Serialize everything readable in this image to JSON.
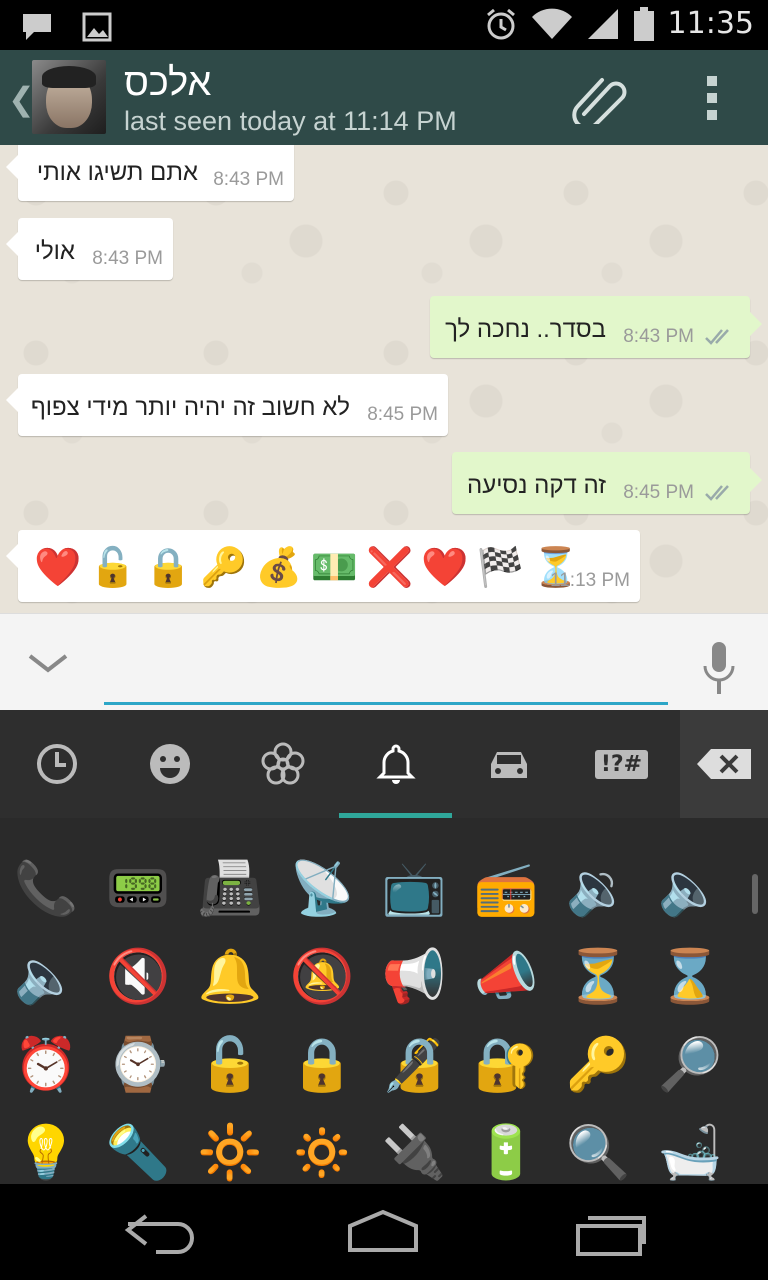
{
  "status_bar": {
    "time": "11:35",
    "icons": [
      "chat-notification-icon",
      "image-notification-icon",
      "alarm-icon",
      "wifi-icon",
      "signal-icon",
      "battery-icon"
    ]
  },
  "header": {
    "contact_name": "אלכס",
    "last_seen": "last seen today at 11:14 PM"
  },
  "messages": [
    {
      "dir": "in",
      "text": "אתם תשיגו אותי",
      "time": "8:43 PM"
    },
    {
      "dir": "in",
      "text": "אולי",
      "time": "8:43 PM"
    },
    {
      "dir": "out",
      "text": "בסדר.. נחכה לך",
      "time": "8:43 PM"
    },
    {
      "dir": "in",
      "text": "לא חשוב זה יהיה יותר מידי צפוף",
      "time": "8:45 PM"
    },
    {
      "dir": "out",
      "text": "זה דקה נסיעה",
      "time": "8:45 PM"
    },
    {
      "dir": "in",
      "emoji": [
        "❤️",
        "🔓",
        "🔒",
        "🔑",
        "💰",
        "💵",
        "❌",
        "❤️",
        "🏁",
        "⏳"
      ],
      "time": "11:13 PM"
    }
  ],
  "input": {
    "value": "",
    "placeholder": ""
  },
  "keyboard": {
    "tabs": [
      "recent-tab",
      "smileys-tab",
      "nature-tab",
      "objects-tab",
      "places-tab",
      "symbols-tab"
    ],
    "symbols_label": "!?#",
    "active_tab": 3,
    "rows": [
      [
        "📞",
        "📟",
        "📠",
        "📡",
        "📺",
        "📻",
        "🔉",
        "🔈"
      ],
      [
        "🔈",
        "🔇",
        "🔔",
        "🔕",
        "📢",
        "📣",
        "⏳",
        "⌛"
      ],
      [
        "⏰",
        "⌚",
        "🔓",
        "🔒",
        "🔏",
        "🔐",
        "🔑",
        "🔎"
      ],
      [
        "💡",
        "🔦",
        "🔆",
        "🔅",
        "🔌",
        "🔋",
        "🔍",
        "🛁"
      ]
    ]
  },
  "colors": {
    "header_bg": "#2f4a48",
    "outgoing_bubble": "#e2f7cb",
    "accent": "#2ca6c7",
    "tab_indicator": "#2fa79a"
  }
}
